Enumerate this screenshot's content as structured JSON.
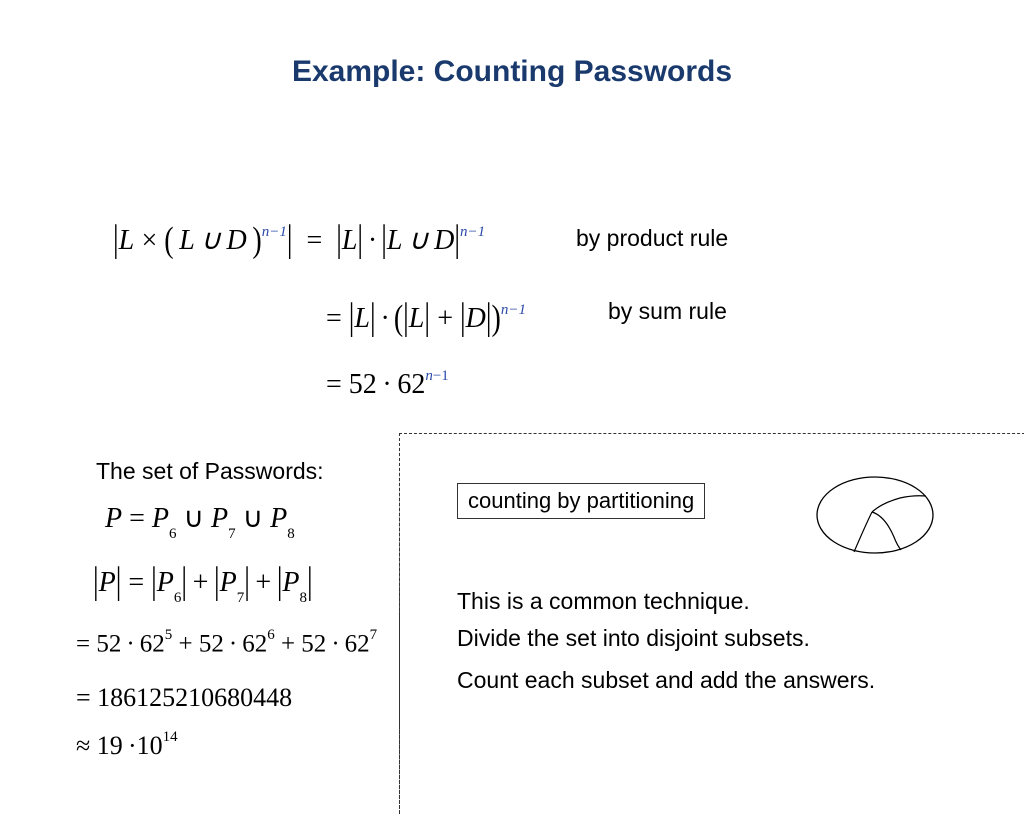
{
  "title": "Example: Counting Passwords",
  "eq1": {
    "lhs": "|L × (L ∪ D)^{n-1}|",
    "parts": {
      "L": "L",
      "D": "D",
      "n": "n",
      "minus1": "−1"
    },
    "rhs1_note": "by product rule",
    "rhs2_note": "by sum rule",
    "numline": {
      "eq": "=",
      "a": "52",
      "dot": "·",
      "b": "62"
    }
  },
  "sets": {
    "heading": "The set of Passwords:",
    "union_line": "P = P₆ ∪ P₇ ∪ P₈",
    "card_line": "|P| = |P₆| + |P₇| + |P₈|",
    "expand": "= 52·62⁵ + 52·62⁶ + 52·62⁷",
    "big": "= 186125210680448",
    "approx": "≈ 19 ·10¹⁴",
    "P": "P",
    "eq": "=",
    "plus": "+",
    "union": "∪",
    "s6": "6",
    "s7": "7",
    "s8": "8",
    "n52": "52",
    "n62": "62",
    "dot": "·",
    "e5": "5",
    "e6": "6",
    "e7": "7",
    "bigval": "186125210680448",
    "approxsym": "≈",
    "n19": "19",
    "n10": "10",
    "e14": "14"
  },
  "box_label": "counting by partitioning",
  "explain": {
    "l1": "This is a common technique.",
    "l2": "Divide the set into disjoint subsets.",
    "l3": "Count each subset and add the answers."
  }
}
